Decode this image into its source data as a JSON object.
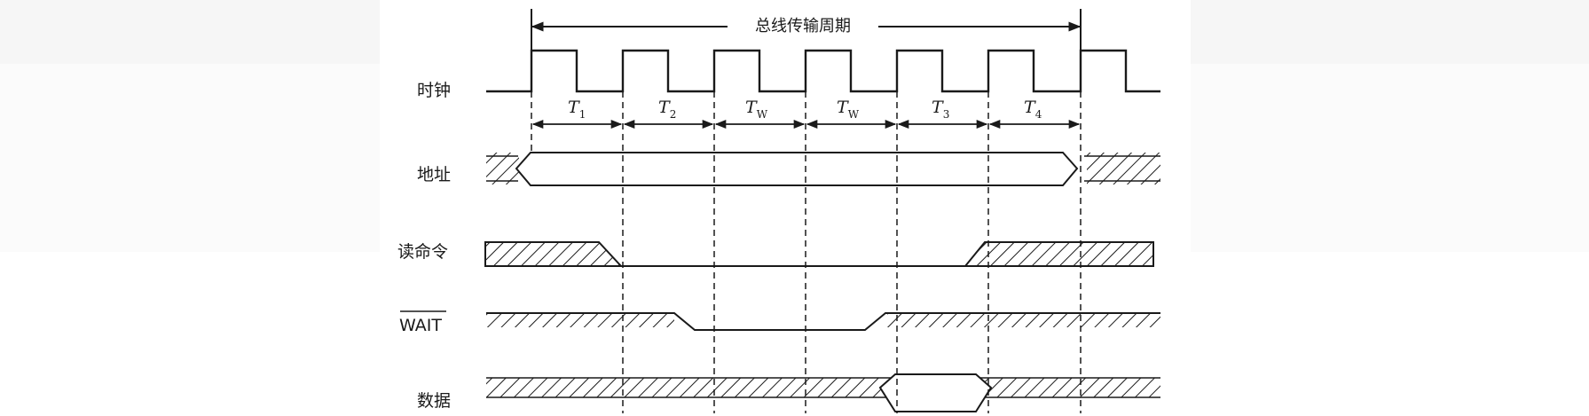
{
  "diagram": {
    "title": "总线传输周期",
    "signals": [
      {
        "id": "clock",
        "label": "时钟"
      },
      {
        "id": "address",
        "label": "地址"
      },
      {
        "id": "read",
        "label": "读命令"
      },
      {
        "id": "wait",
        "label": "WAIT",
        "overline": true
      },
      {
        "id": "data",
        "label": "数据"
      }
    ],
    "periods": [
      {
        "letter": "T",
        "sub": "1"
      },
      {
        "letter": "T",
        "sub": "2"
      },
      {
        "letter": "T",
        "sub": "W"
      },
      {
        "letter": "T",
        "sub": "W"
      },
      {
        "letter": "T",
        "sub": "3"
      },
      {
        "letter": "T",
        "sub": "4"
      }
    ],
    "colors": {
      "ink": "#1a1a1a",
      "background": "#ffffff"
    }
  }
}
